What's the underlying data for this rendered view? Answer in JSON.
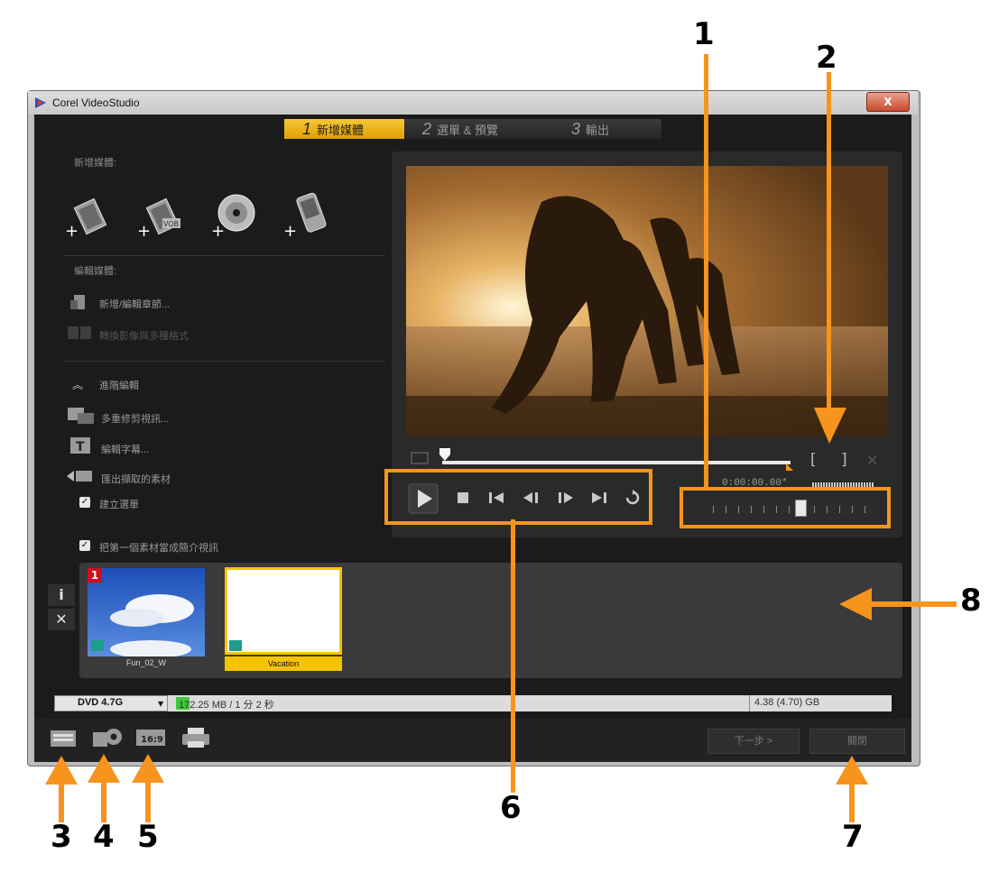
{
  "window": {
    "title": "Corel VideoStudio",
    "close_label": "X"
  },
  "steps": [
    {
      "num": "1",
      "label": "新增媒體"
    },
    {
      "num": "2",
      "label": "選單 & 預覽"
    },
    {
      "num": "3",
      "label": "輸出"
    }
  ],
  "left_panel": {
    "add_media_label": "新增媒體:",
    "edit_media_label": "編輯媒體:",
    "add_edit_chapter": "新增/編輯章節...",
    "convert_multi": "轉換影像與多種格式",
    "advanced_edit": "進階編輯",
    "multi_trim": "多重修剪視訊...",
    "edit_subtitles": "編輯字幕...",
    "import_media": "匯出擷取的素材",
    "create_menu": "建立選單",
    "first_clip_intro": "把第一個素材當成簡介視訊"
  },
  "preview": {
    "timecode": "0:00:00.00*",
    "mark_in": "[",
    "mark_out": "]",
    "clear": "✕"
  },
  "clips": [
    {
      "badge": "1",
      "label": "Fun_02_W"
    },
    {
      "label": "Vacation"
    }
  ],
  "storage": {
    "disc": "DVD 4.7G",
    "used": "172.25 MB / 1 分 2 秒",
    "capacity": "4.38 (4.70) GB",
    "used_fraction": 0.037
  },
  "buttons": {
    "next": "下一步 >",
    "close": "關閉"
  },
  "callouts": [
    "1",
    "2",
    "3",
    "4",
    "5",
    "6",
    "7",
    "8"
  ],
  "side_buttons": {
    "info": "i",
    "remove": "✕"
  },
  "colors": {
    "accent": "#f7941d",
    "step_active": "#f0b41c",
    "clip_selected": "#f5c400"
  }
}
